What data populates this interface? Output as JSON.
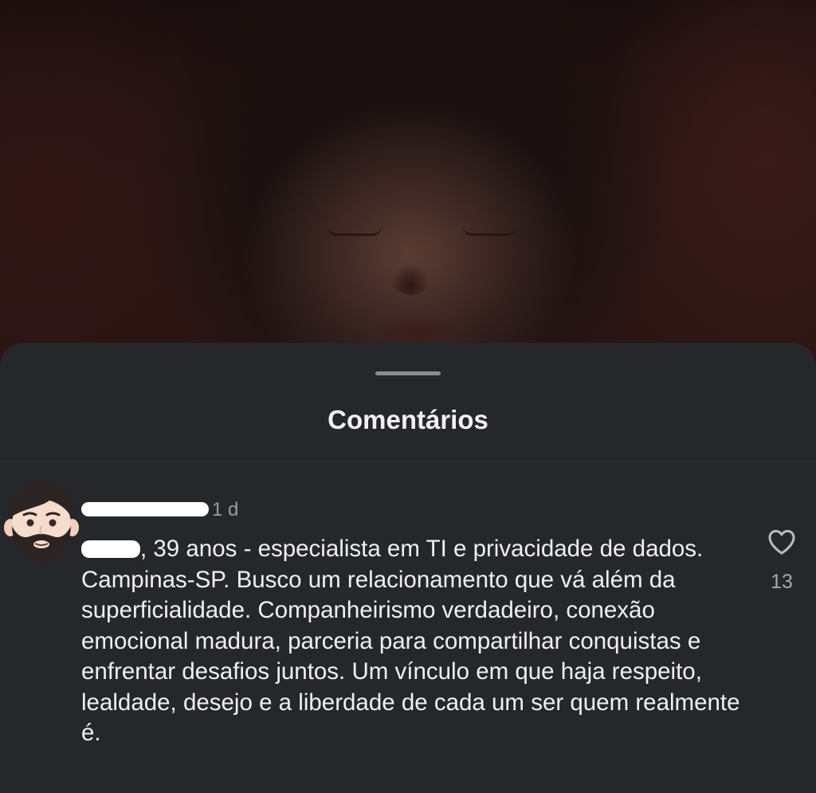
{
  "sheet": {
    "title": "Comentários"
  },
  "comment": {
    "time_ago": "1 d",
    "text": ", 39 anos - especialista em TI e privacidade de dados. Campinas-SP.  Busco um relacionamento que vá além da superficialidade. Companheirismo verdadeiro, conexão emocional madura, parceria para compartilhar conquistas e enfrentar desafios juntos. Um vínculo em que haja respeito, lealdade, desejo e a liberdade de cada um ser quem realmente é.",
    "likes": "13",
    "avatar_icon": "man-beard-emoji-icon",
    "like_icon": "heart-outline-icon"
  },
  "colors": {
    "sheet_background": "#26272b",
    "text_primary": "#f0f0f2",
    "text_secondary": "#9a9ba0",
    "redaction": "#ffffff"
  }
}
